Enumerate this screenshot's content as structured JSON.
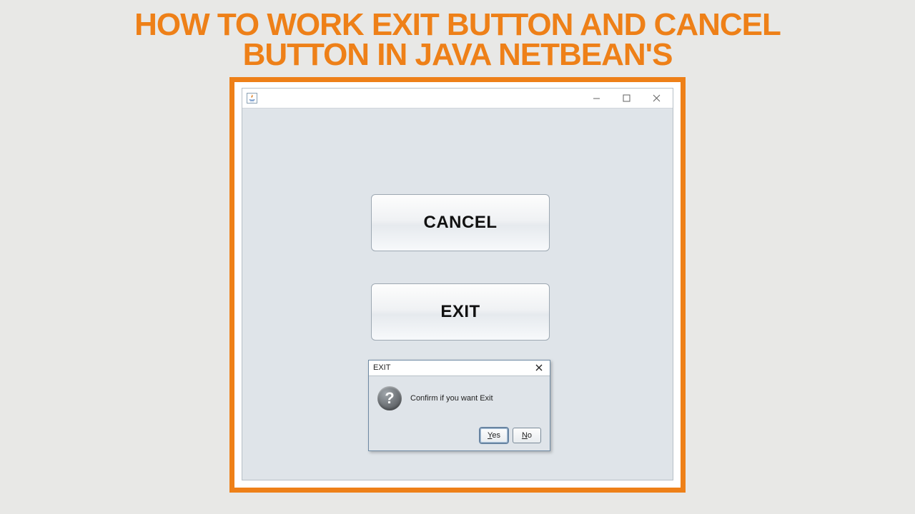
{
  "heading_line1": "HOW TO WORK EXIT BUTTON AND CANCEL",
  "heading_line2": "BUTTON IN JAVA NETBEAN'S",
  "window": {
    "title": "",
    "buttons": {
      "cancel": "CANCEL",
      "exit": "EXIT"
    }
  },
  "dialog": {
    "title": "EXIT",
    "icon_char": "?",
    "message": "Confirm if you want Exit",
    "yes": "Yes",
    "no": "No"
  }
}
